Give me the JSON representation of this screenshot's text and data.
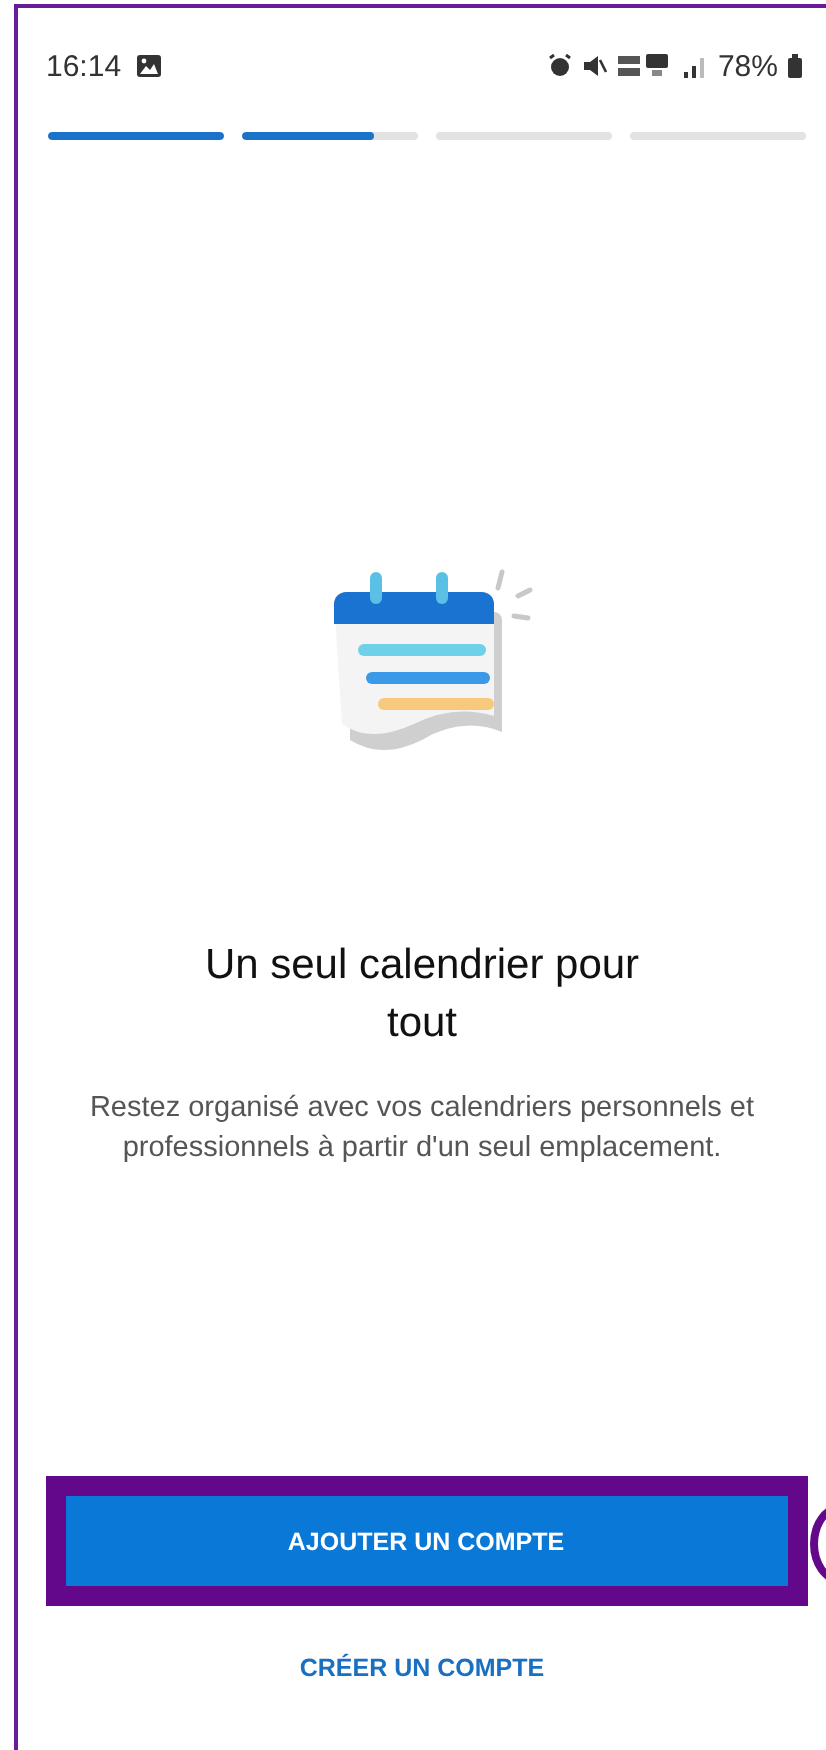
{
  "status_bar": {
    "time": "16:14",
    "battery": "78%"
  },
  "progress": [
    {
      "level": 1
    },
    {
      "level": 0.75
    },
    {
      "level": 0
    },
    {
      "level": 0
    }
  ],
  "title": "Un seul calendrier pour tout",
  "description": "Restez organisé avec vos calendriers personnels et professionnels à partir d'un seul emplacement.",
  "primary_button": {
    "label": "AJOUTER UN COMPTE",
    "highlighted": true
  },
  "secondary_link": "CRÉER UN COMPTE"
}
